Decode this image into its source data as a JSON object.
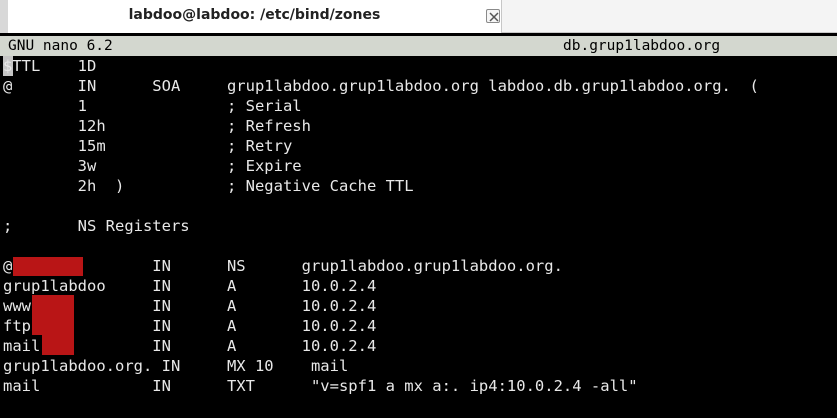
{
  "window": {
    "title": "labdoo@labdoo: /etc/bind/zones"
  },
  "nano": {
    "version": "GNU nano 6.2",
    "filename": "db.grup1labdoo.org"
  },
  "lines": [
    "$TTL    1D",
    "@       IN      SOA     grup1labdoo.grup1labdoo.org labdoo.db.grup1labdoo.org.  (",
    "        1               ; Serial",
    "        12h             ; Refresh",
    "        15m             ; Retry",
    "        3w              ; Expire",
    "        2h  )           ; Negative Cache TTL",
    "",
    ";       NS Registers",
    "",
    "@               IN      NS      grup1labdoo.grup1labdoo.org.",
    "grup1labdoo     IN      A       10.0.2.4",
    "www             IN      A       10.0.2.4",
    "ftp             IN      A       10.0.2.4",
    "mail            IN      A       10.0.2.4",
    "grup1labdoo.org. IN     MX 10    mail",
    "mail            IN      TXT      \"v=spf1 a mx a:. ip4:10.0.2.4 -all\""
  ],
  "colors": {
    "terminal_bg": "#000000",
    "terminal_fg": "#e8e8e8",
    "header_bg": "#d3d7cf",
    "redaction": "#b91516"
  }
}
